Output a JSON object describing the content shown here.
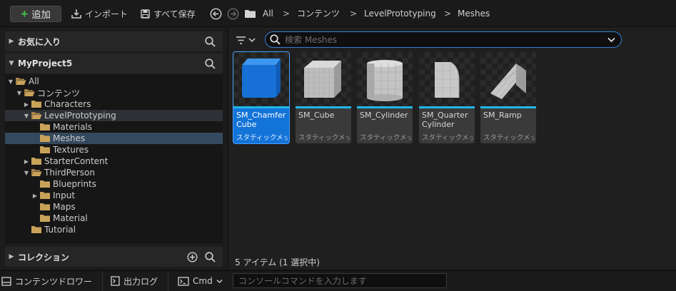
{
  "toolbar": {
    "add_label": "追加",
    "import_label": "インポート",
    "save_all_label": "すべて保存",
    "breadcrumbs": [
      "All",
      "コンテンツ",
      "LevelPrototyping",
      "Meshes"
    ],
    "breadcrumb_separator": ">"
  },
  "left_panel": {
    "favorites_title": "お気に入り",
    "project_title": "MyProject5",
    "collections_title": "コレクション",
    "tree": [
      {
        "label": "All",
        "level": 0,
        "expanded": true
      },
      {
        "label": "コンテンツ",
        "level": 1,
        "expanded": true
      },
      {
        "label": "Characters",
        "level": 2,
        "expanded": false
      },
      {
        "label": "LevelPrototyping",
        "level": 2,
        "expanded": true
      },
      {
        "label": "Materials",
        "level": 3
      },
      {
        "label": "Meshes",
        "level": 3,
        "selected": true
      },
      {
        "label": "Textures",
        "level": 3
      },
      {
        "label": "StarterContent",
        "level": 2,
        "expanded": false
      },
      {
        "label": "ThirdPerson",
        "level": 2,
        "expanded": true
      },
      {
        "label": "Blueprints",
        "level": 3
      },
      {
        "label": "Input",
        "level": 3,
        "expanded": false
      },
      {
        "label": "Maps",
        "level": 3
      },
      {
        "label": "Material",
        "level": 3
      },
      {
        "label": "Tutorial",
        "level": 2
      }
    ]
  },
  "content": {
    "search_placeholder": "検索 Meshes",
    "assets": [
      {
        "name": "SM_ChamferCube",
        "type": "スタティックメッシュ",
        "thumb": "chamfer-cube",
        "selected": true
      },
      {
        "name": "SM_Cube",
        "type": "スタティックメッシュ",
        "thumb": "cube"
      },
      {
        "name": "SM_Cylinder",
        "type": "スタティックメッシュ",
        "thumb": "cylinder"
      },
      {
        "name": "SM_QuarterCylinder",
        "type": "スタティックメッシュ",
        "thumb": "quarter-cylinder"
      },
      {
        "name": "SM_Ramp",
        "type": "スタティックメッシュ",
        "thumb": "ramp"
      }
    ],
    "status": "5 アイテム (1 選択中)"
  },
  "bottom_bar": {
    "content_drawer_label": "コンテンツドロワー",
    "output_log_label": "出力ログ",
    "cmd_label": "Cmd",
    "console_placeholder": "コンソールコマンドを入力します"
  },
  "colors": {
    "accent_blue": "#1374d8",
    "asset_bar": "#1fb8e8",
    "folder": "#c9a25a",
    "add_plus": "#3fbf3f"
  }
}
